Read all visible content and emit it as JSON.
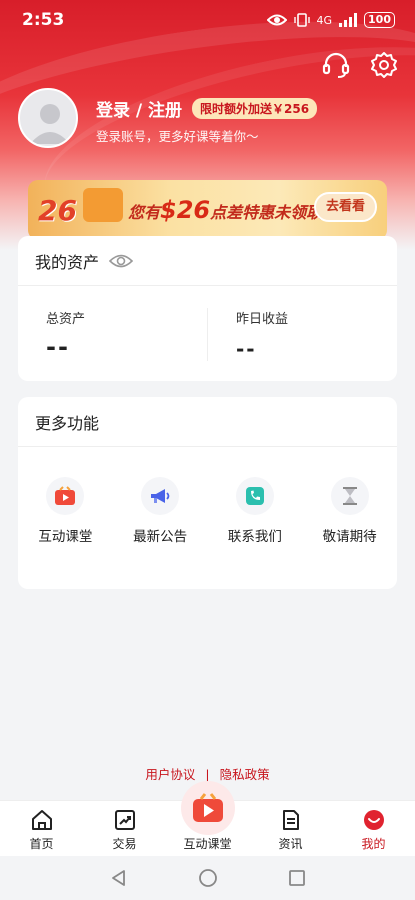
{
  "status_bar": {
    "time": "2:53",
    "network": "4G",
    "battery": "100"
  },
  "header": {
    "login_title": "登录 / 注册",
    "bonus_badge": "限时额外加送￥256",
    "login_subtitle": "登录账号，更多好课等着你～"
  },
  "promo_banner": {
    "badge_number": "26",
    "text_prefix": "您有",
    "amount": "$26",
    "text_suffix": "点差特惠未领取?",
    "button": "去看看"
  },
  "assets": {
    "title": "我的资产",
    "total_label": "总资产",
    "total_value": "--",
    "yesterday_label": "昨日收益",
    "yesterday_value": "--"
  },
  "more_functions": {
    "title": "更多功能",
    "items": [
      {
        "label": "互动课堂",
        "icon": "video-play-icon"
      },
      {
        "label": "最新公告",
        "icon": "megaphone-icon"
      },
      {
        "label": "联系我们",
        "icon": "phone-icon"
      },
      {
        "label": "敬请期待",
        "icon": "hourglass-icon"
      }
    ]
  },
  "footer": {
    "user_agreement": "用户协议",
    "separator": "|",
    "privacy_policy": "隐私政策"
  },
  "tabbar": {
    "items": [
      {
        "label": "首页",
        "icon": "home-icon"
      },
      {
        "label": "交易",
        "icon": "trade-chart-icon"
      },
      {
        "label": "互动课堂",
        "icon": "classroom-icon"
      },
      {
        "label": "资讯",
        "icon": "news-icon"
      },
      {
        "label": "我的",
        "icon": "profile-icon"
      }
    ],
    "active_index": 4
  },
  "colors": {
    "brand_red": "#c8161e",
    "hero_red": "#d81e2a",
    "badge_bg": "#fde6b9"
  }
}
